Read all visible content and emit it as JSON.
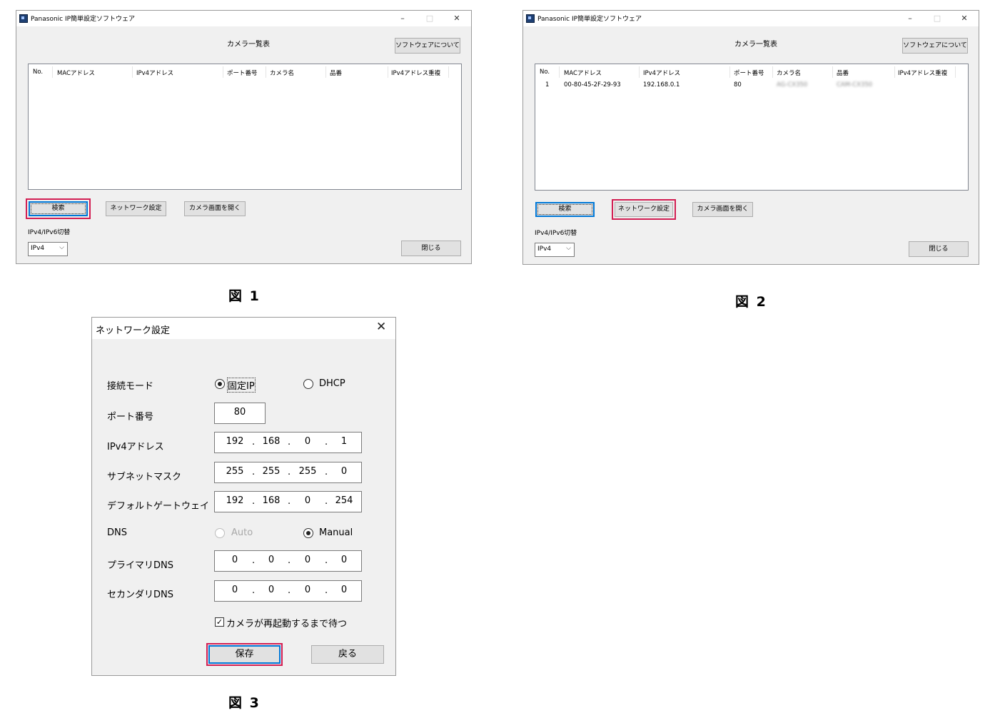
{
  "figure1": {
    "caption": "図 1",
    "window": {
      "title": "Panasonic IP簡単設定ソフトウェア",
      "heading": "カメラ一覧表",
      "about_button": "ソフトウェアについて",
      "columns": [
        "No.",
        "MACアドレス",
        "IPv4アドレス",
        "ポート番号",
        "カメラ名",
        "品番",
        "IPv4アドレス重複"
      ],
      "rows": [],
      "search_button": "検索",
      "network_button": "ネットワーク設定",
      "open_camera_button": "カメラ画面を開く",
      "ip_switch_label": "IPv4/IPv6切替",
      "ip_mode": "IPv4",
      "close_button": "閉じる"
    },
    "highlighted": "search-button"
  },
  "figure2": {
    "caption": "図 2",
    "window": {
      "title": "Panasonic IP簡単設定ソフトウェア",
      "heading": "カメラ一覧表",
      "about_button": "ソフトウェアについて",
      "columns": [
        "No.",
        "MACアドレス",
        "IPv4アドレス",
        "ポート番号",
        "カメラ名",
        "品番",
        "IPv4アドレス重複"
      ],
      "rows": [
        {
          "no": "1",
          "mac": "00-80-45-2F-29-93",
          "ipv4": "192.168.0.1",
          "port": "80",
          "camera_name": "AG-CX350",
          "model": "CAM-CX350",
          "duplicate": ""
        }
      ],
      "search_button": "検索",
      "network_button": "ネットワーク設定",
      "open_camera_button": "カメラ画面を開く",
      "ip_switch_label": "IPv4/IPv6切替",
      "ip_mode": "IPv4",
      "close_button": "閉じる"
    },
    "highlighted": "network-settings-button"
  },
  "figure3": {
    "caption": "図 3",
    "dialog": {
      "title": "ネットワーク設定",
      "connection_mode_label": "接続モード",
      "mode_static": "固定IP",
      "mode_dhcp": "DHCP",
      "mode_selected": "static",
      "port_label": "ポート番号",
      "port_value": "80",
      "ipv4_label": "IPv4アドレス",
      "ipv4": [
        "192",
        "168",
        "0",
        "1"
      ],
      "subnet_label": "サブネットマスク",
      "subnet": [
        "255",
        "255",
        "255",
        "0"
      ],
      "gateway_label": "デフォルトゲートウェイ",
      "gateway": [
        "192",
        "168",
        "0",
        "254"
      ],
      "dns_label": "DNS",
      "dns_auto": "Auto",
      "dns_manual": "Manual",
      "dns_selected": "manual",
      "primary_dns_label": "プライマリDNS",
      "primary_dns": [
        "0",
        "0",
        "0",
        "0"
      ],
      "secondary_dns_label": "セカンダリDNS",
      "secondary_dns": [
        "0",
        "0",
        "0",
        "0"
      ],
      "wait_restart_label": "カメラが再起動するまで待つ",
      "wait_restart_checked": true,
      "save_button": "保存",
      "back_button": "戻る"
    },
    "highlighted": "save-button"
  },
  "colors": {
    "highlight": "#d21e52",
    "focus": "#0078d7",
    "window_bg": "#f0f0f0"
  }
}
